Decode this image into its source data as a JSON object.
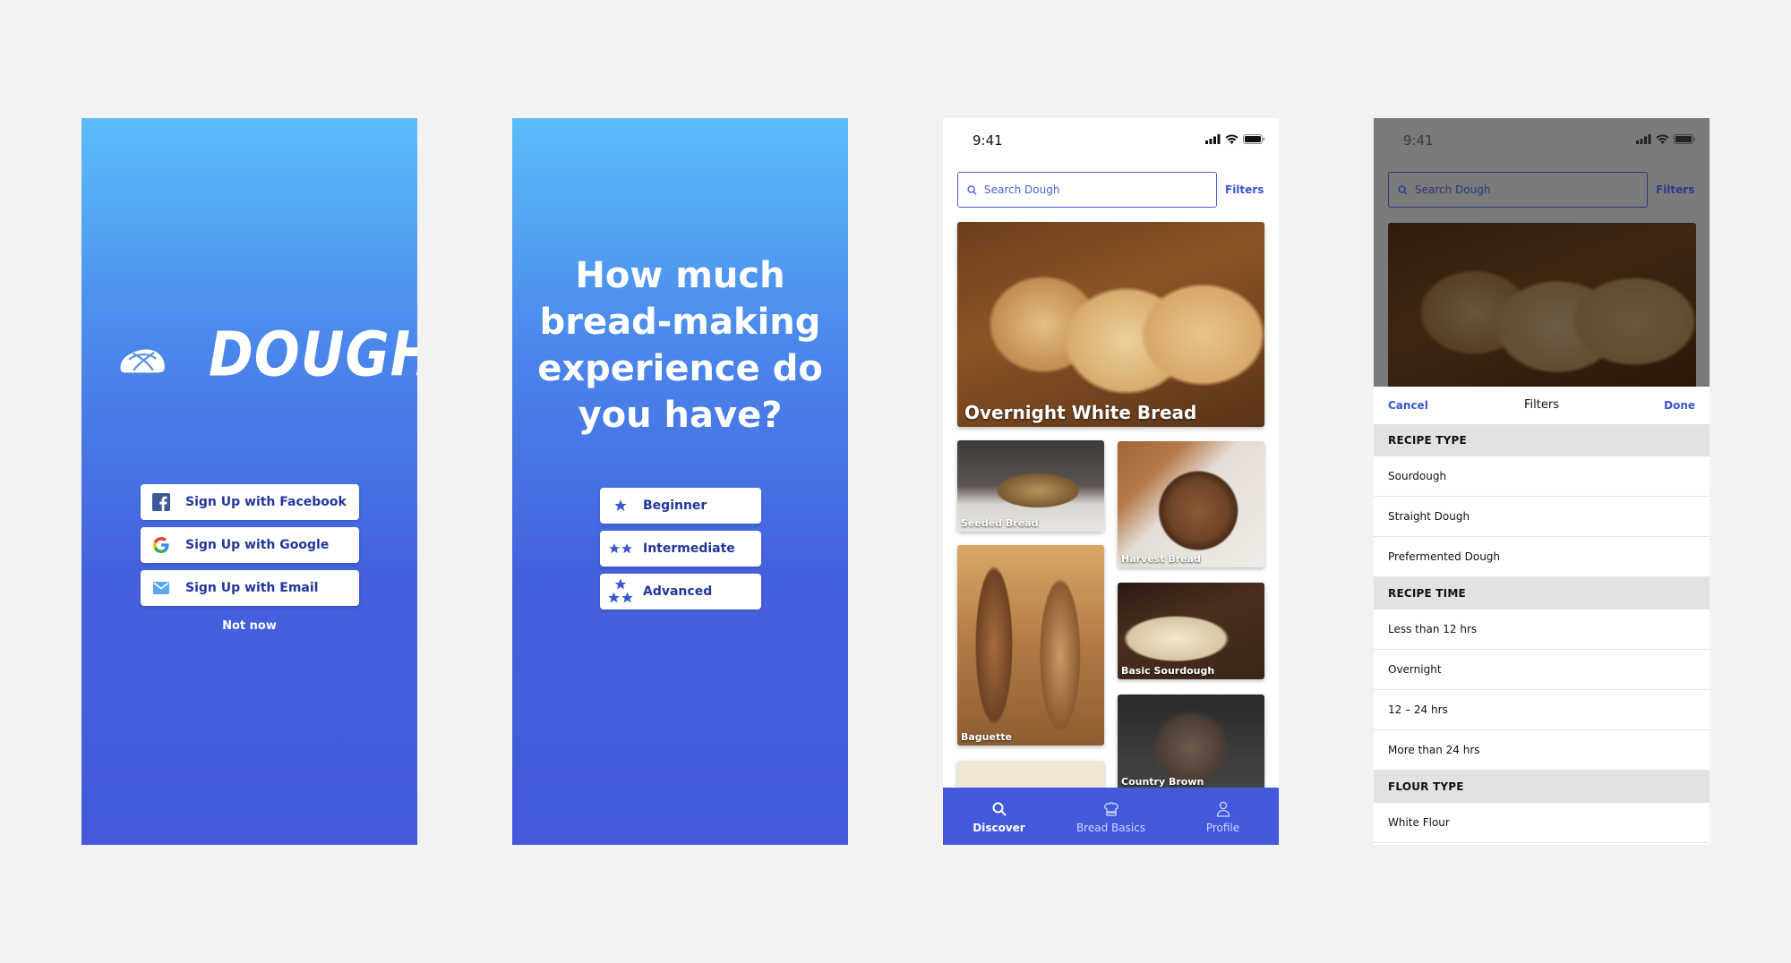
{
  "colors": {
    "brand_blue": "#4259db",
    "gradient_top": "#5cbdfa",
    "link_blue": "#3a55d0",
    "button_text": "#23379b"
  },
  "welcome": {
    "brand": "DOUGH",
    "buttons": [
      {
        "label": "Sign Up with Facebook",
        "icon": "facebook-icon"
      },
      {
        "label": "Sign Up with Google",
        "icon": "google-icon"
      },
      {
        "label": "Sign Up with Email",
        "icon": "email-icon"
      }
    ],
    "not_now": "Not now"
  },
  "experience": {
    "question": "How much bread-making experience do you have?",
    "options": [
      {
        "label": "Beginner",
        "stars": 1
      },
      {
        "label": "Intermediate",
        "stars": 2
      },
      {
        "label": "Advanced",
        "stars": 3
      }
    ]
  },
  "discover": {
    "status_time": "9:41",
    "search_placeholder": "Search Dough",
    "filters_link": "Filters",
    "featured": "Overnight White Bread",
    "recipes": [
      "Seeded Bread",
      "Harvest Bread",
      "Baguette",
      "Basic Sourdough",
      "Country Brown"
    ],
    "tabs": [
      {
        "label": "Discover",
        "icon": "search-icon",
        "active": true
      },
      {
        "label": "Bread Basics",
        "icon": "chef-hat-icon",
        "active": false
      },
      {
        "label": "Profile",
        "icon": "user-icon",
        "active": false
      }
    ]
  },
  "filters": {
    "status_time": "9:41",
    "search_placeholder": "Search Dough",
    "filters_link": "Filters",
    "cancel": "Cancel",
    "title": "Filters",
    "done": "Done",
    "sections": [
      {
        "title": "RECIPE TYPE",
        "items": [
          "Sourdough",
          "Straight Dough",
          "Prefermented Dough"
        ]
      },
      {
        "title": "RECIPE TIME",
        "items": [
          "Less than 12 hrs",
          "Overnight",
          "12 – 24 hrs",
          "More than 24 hrs"
        ]
      },
      {
        "title": "FLOUR TYPE",
        "items": [
          "White Flour"
        ]
      }
    ]
  }
}
